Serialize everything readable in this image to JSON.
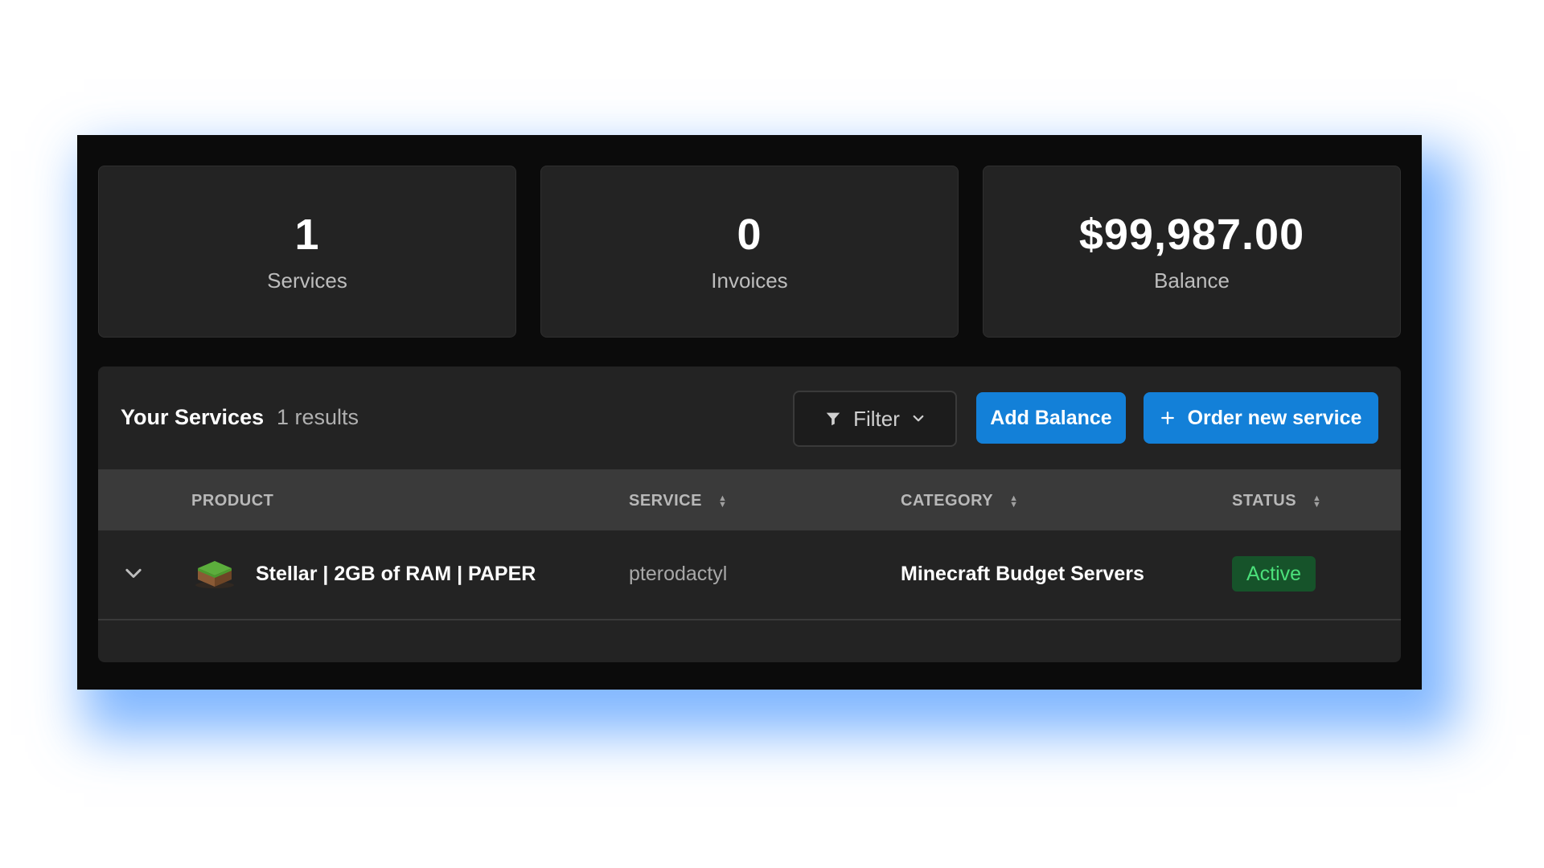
{
  "stats": [
    {
      "value": "1",
      "label": "Services"
    },
    {
      "value": "0",
      "label": "Invoices"
    },
    {
      "value": "$99,987.00",
      "label": "Balance"
    }
  ],
  "services": {
    "title": "Your Services",
    "count": "1 results",
    "filter_label": "Filter",
    "add_balance_label": "Add Balance",
    "order_label": "Order new service",
    "columns": {
      "product": "PRODUCT",
      "service": "SERVICE",
      "category": "CATEGORY",
      "status": "STATUS"
    },
    "rows": [
      {
        "product": "Stellar | 2GB of RAM | PAPER",
        "service": "pterodactyl",
        "category": "Minecraft Budget Servers",
        "status": "Active"
      }
    ]
  },
  "colors": {
    "accent": "#1380d8",
    "status_active_bg": "#16532a",
    "status_active_text": "#4be07a",
    "panel_bg": "#0b0b0b",
    "card_bg": "#232323"
  },
  "icons": {
    "filter": "filter-icon",
    "chevron": "chevron-down-icon",
    "plus": "plus-icon",
    "sort": "sort-icon",
    "product_thumbnail": "minecraft-grass-block-icon"
  }
}
